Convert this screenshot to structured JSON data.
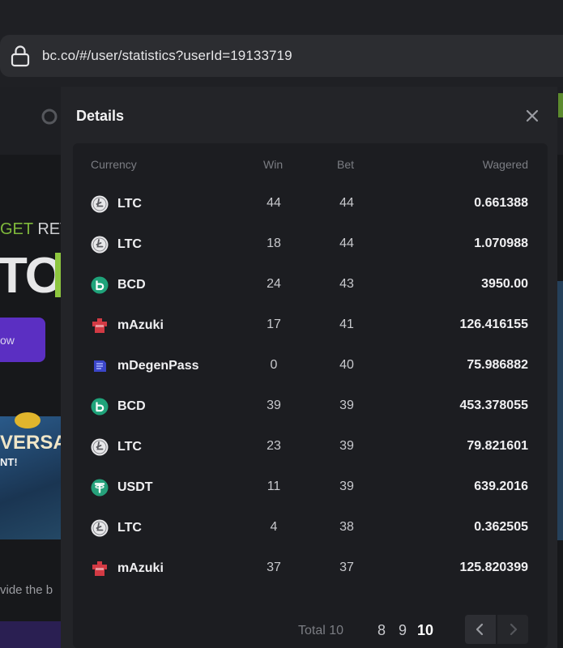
{
  "browser": {
    "url": "bc.co/#/user/statistics?userId=19133719"
  },
  "background": {
    "get_text": "GET",
    "rev_text": "REV",
    "big_text": "TO",
    "button_text": "ow",
    "banner_text": "VERSA",
    "banner_sub": "NT!",
    "footer_text": "vide the b"
  },
  "modal": {
    "title": "Details",
    "columns": {
      "currency": "Currency",
      "win": "Win",
      "bet": "Bet",
      "wagered": "Wagered"
    },
    "rows": [
      {
        "currency": "LTC",
        "icon": "ltc-icon",
        "win": "44",
        "bet": "44",
        "wagered": "0.661388"
      },
      {
        "currency": "LTC",
        "icon": "ltc-icon",
        "win": "18",
        "bet": "44",
        "wagered": "1.070988"
      },
      {
        "currency": "BCD",
        "icon": "bcd-icon",
        "win": "24",
        "bet": "43",
        "wagered": "3950.00"
      },
      {
        "currency": "mAzuki",
        "icon": "mazuki-icon",
        "win": "17",
        "bet": "41",
        "wagered": "126.416155"
      },
      {
        "currency": "mDegenPass",
        "icon": "mdegenpass-icon",
        "win": "0",
        "bet": "40",
        "wagered": "75.986882"
      },
      {
        "currency": "BCD",
        "icon": "bcd-icon",
        "win": "39",
        "bet": "39",
        "wagered": "453.378055"
      },
      {
        "currency": "LTC",
        "icon": "ltc-icon",
        "win": "23",
        "bet": "39",
        "wagered": "79.821601"
      },
      {
        "currency": "USDT",
        "icon": "usdt-icon",
        "win": "11",
        "bet": "39",
        "wagered": "639.2016"
      },
      {
        "currency": "LTC",
        "icon": "ltc-icon",
        "win": "4",
        "bet": "38",
        "wagered": "0.362505"
      },
      {
        "currency": "mAzuki",
        "icon": "mazuki-icon",
        "win": "37",
        "bet": "37",
        "wagered": "125.820399"
      }
    ],
    "pagination": {
      "total_label": "Total 10",
      "pages": [
        "8",
        "9",
        "10"
      ],
      "current_page": "10"
    }
  },
  "colors": {
    "modal_bg": "#232428",
    "panel_bg": "#1c1d21",
    "ltc": "#e8e8ea",
    "bcd": "#1fa37a",
    "usdt": "#26a17b",
    "mazuki": "#d23a44",
    "mdegenpass": "#3b46c9"
  }
}
